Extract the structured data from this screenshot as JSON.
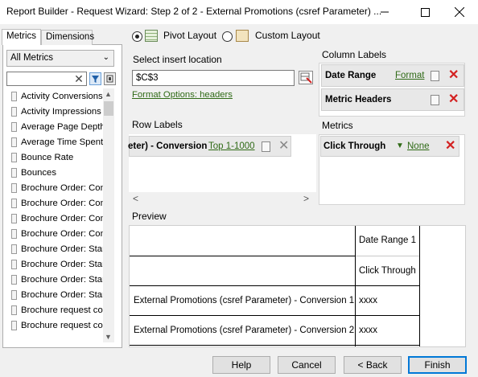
{
  "window": {
    "title": "Report Builder - Request Wizard: Step 2 of 2 - External Promotions (csref Parameter) ..."
  },
  "left_panel": {
    "tabs": [
      {
        "label": "Metrics",
        "active": true
      },
      {
        "label": "Dimensions",
        "active": false
      }
    ],
    "filter_select": "All Metrics",
    "search": {
      "value": "",
      "placeholder": ""
    },
    "metrics": [
      "Activity Conversions",
      "Activity Impressions",
      "Average Page Depth",
      "Average Time Spent o",
      "Bounce Rate",
      "Bounces",
      "Brochure Order: Comp",
      "Brochure Order: Comp",
      "Brochure Order: Comp",
      "Brochure Order: Comp",
      "Brochure Order: Starte",
      "Brochure Order: Starte",
      "Brochure Order: Starte",
      "Brochure Order: Starte",
      "Brochure request com",
      "Brochure request com"
    ]
  },
  "layout": {
    "pivot_label": "Pivot Layout",
    "custom_label": "Custom Layout",
    "selected": "pivot"
  },
  "insert": {
    "label": "Select insert location",
    "value": "$C$3",
    "format_link": "Format Options: headers"
  },
  "column_labels": {
    "title": "Column Labels",
    "items": [
      {
        "label": "Date Range",
        "link": "Format"
      },
      {
        "label": "Metric Headers",
        "link": ""
      }
    ]
  },
  "row_labels": {
    "title": "Row Labels",
    "item": {
      "label": "eter) - Conversion",
      "link": "Top 1-1000"
    }
  },
  "metrics_zone": {
    "title": "Metrics",
    "item": {
      "label": "Click Through",
      "link": "None"
    }
  },
  "preview": {
    "title": "Preview",
    "header1": "Date Range 1",
    "header2": "Click Through",
    "rows": [
      {
        "label": "External Promotions (csref Parameter) - Conversion 1",
        "value": "xxxx"
      },
      {
        "label": "External Promotions (csref Parameter) - Conversion 2",
        "value": "xxxx"
      }
    ]
  },
  "buttons": {
    "help": "Help",
    "cancel": "Cancel",
    "back": "< Back",
    "finish": "Finish"
  },
  "colors": {
    "link_green": "#2f6a16",
    "delete_red": "#d32020",
    "accent_blue": "#0078d7"
  }
}
